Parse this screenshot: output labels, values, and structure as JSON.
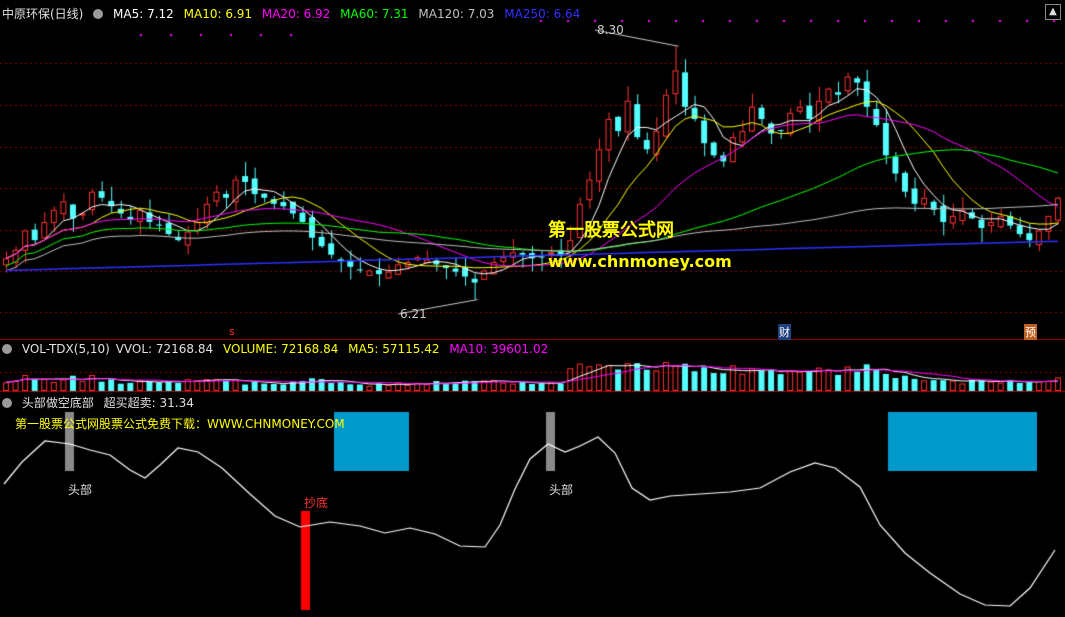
{
  "main_header": {
    "title": "中原环保(日线)",
    "ma5": "MA5: 7.12",
    "ma10": "MA10: 6.91",
    "ma20": "MA20: 6.92",
    "ma60": "MA60: 7.31",
    "ma120": "MA120: 7.03",
    "ma250": "MA250: 6.64"
  },
  "price_labels": {
    "high": "8.30",
    "low": "6.21"
  },
  "watermark": {
    "cn": "第一股票公式网",
    "url": "www.chnmoney.com"
  },
  "event_markers": {
    "s": "s",
    "cai": "财",
    "yu": "预"
  },
  "vol_header": {
    "title": "VOL-TDX(5,10)",
    "vvol": "VVOL: 72168.84",
    "volume": "VOLUME: 72168.84",
    "ma5": "MA5: 57115.42",
    "ma10": "MA10: 39601.02"
  },
  "ind_header": {
    "title": "头部做空底部",
    "value": "超买超卖: 31.34",
    "promo": "第一股票公式网股票公式免费下载：WWW.CHNMONEY.COM"
  },
  "ind_labels": {
    "head": "头部",
    "bottom": "抄底"
  },
  "colors": {
    "up": "#ff3232",
    "down": "#54ffff",
    "ma5": "#ffffff",
    "ma10": "#ffff00",
    "ma20": "#ff00ff",
    "ma60": "#00ff00",
    "ma120": "#c0c0c0",
    "ma250": "#3030ff",
    "grid": "#8b0000",
    "zone": "#0099cc"
  },
  "chart_data": {
    "type": "candlestick",
    "ylim": [
      6.0,
      8.5
    ],
    "highest": 8.3,
    "lowest": 6.21,
    "closes": [
      6.55,
      6.62,
      6.78,
      6.7,
      6.85,
      6.95,
      7.02,
      6.88,
      6.92,
      7.1,
      7.05,
      6.98,
      6.92,
      6.87,
      6.95,
      6.85,
      6.82,
      6.75,
      6.7,
      6.77,
      6.85,
      7.0,
      7.1,
      7.05,
      7.2,
      7.18,
      7.08,
      7.05,
      7.0,
      6.98,
      6.92,
      6.85,
      6.72,
      6.65,
      6.58,
      6.52,
      6.48,
      6.45,
      6.45,
      6.42,
      6.44,
      6.5,
      6.52,
      6.56,
      6.54,
      6.5,
      6.47,
      6.44,
      6.4,
      6.35,
      6.45,
      6.52,
      6.56,
      6.6,
      6.58,
      6.55,
      6.56,
      6.6,
      6.58,
      6.7,
      7.0,
      7.2,
      7.45,
      7.7,
      7.6,
      7.85,
      7.55,
      7.45,
      7.6,
      7.9,
      8.1,
      7.8,
      7.7,
      7.5,
      7.4,
      7.35,
      7.55,
      7.6,
      7.8,
      7.7,
      7.58,
      7.6,
      7.75,
      7.8,
      7.7,
      7.85,
      7.95,
      7.9,
      8.05,
      8.0,
      7.8,
      7.65,
      7.4,
      7.25,
      7.1,
      7.0,
      7.05,
      6.95,
      6.85,
      6.9,
      6.95,
      6.88,
      6.8,
      6.85,
      6.9,
      6.82,
      6.75,
      6.7,
      6.78,
      6.9,
      7.05
    ]
  }
}
